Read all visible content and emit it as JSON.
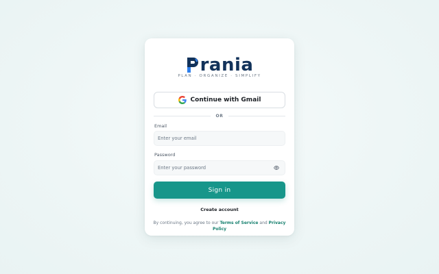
{
  "brand": {
    "name": "rania",
    "logo_letter": "P",
    "tagline": "PLAN · ORGANIZE · SIMPLIFY",
    "color": "#12325a",
    "accent": "#2f80ed"
  },
  "social": {
    "gmail_label": "Continue with Gmail",
    "icon": "google-icon"
  },
  "divider": {
    "text": "OR"
  },
  "form": {
    "email_label": "Email",
    "email_placeholder": "Enter your email",
    "password_label": "Password",
    "password_placeholder": "Enter your password",
    "password_toggle_icon": "eye-icon",
    "submit_label": "Sign in",
    "submit_color": "#17968a"
  },
  "footer": {
    "create_account": "Create account",
    "terms_prefix": "By continuing, you agree to our",
    "terms_link": "Terms of Service",
    "terms_and": "and",
    "privacy_link": "Privacy Policy",
    "link_color": "#17806f"
  }
}
